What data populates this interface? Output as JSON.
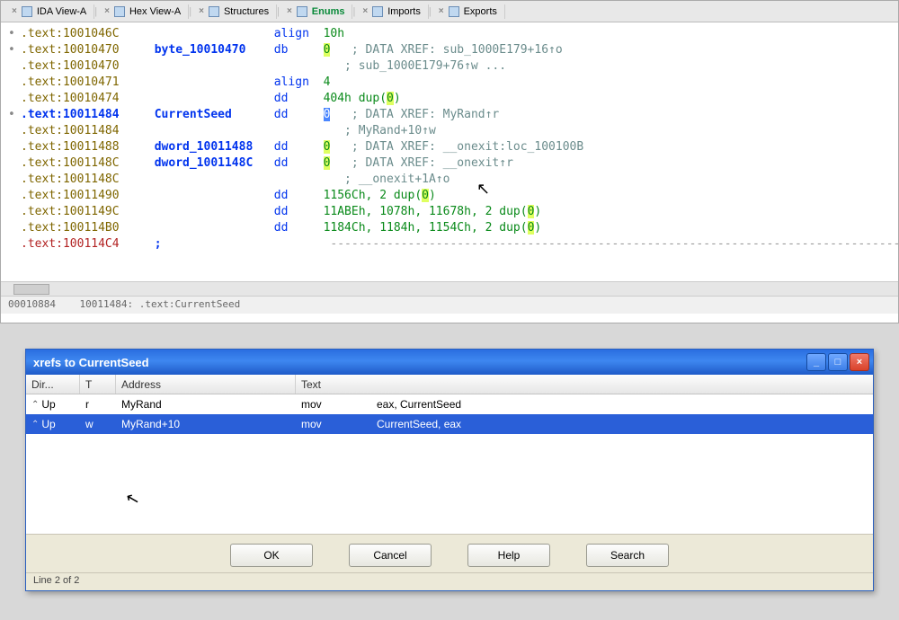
{
  "tabs": [
    {
      "label": "IDA View-A",
      "active": false
    },
    {
      "label": "Hex View-A",
      "active": false
    },
    {
      "label": "Structures",
      "active": false
    },
    {
      "label": "Enums",
      "active": true
    },
    {
      "label": "Imports",
      "active": false
    },
    {
      "label": "Exports",
      "active": false
    }
  ],
  "disasm_lines": [
    {
      "arrow": "•",
      "addr": ".text:1001046C",
      "label": "",
      "op": "align",
      "args": "10h",
      "cmt": ""
    },
    {
      "arrow": "•",
      "addr": ".text:10010470",
      "label": "byte_10010470",
      "op": "db",
      "args": "0",
      "hl": true,
      "cmt": "; DATA XREF: sub_1000E179+16↑o"
    },
    {
      "arrow": " ",
      "addr": ".text:10010470",
      "label": "",
      "op": "",
      "args": "",
      "cmt": "; sub_1000E179+76↑w ..."
    },
    {
      "arrow": " ",
      "addr": ".text:10010471",
      "label": "",
      "op": "align",
      "args": "4",
      "cmt": ""
    },
    {
      "arrow": " ",
      "addr": ".text:10010474",
      "label": "",
      "op": "dd",
      "args": "404h dup(0)",
      "hlparen": true,
      "cmt": ""
    },
    {
      "arrow": "•",
      "addr": ".text:10011484",
      "label": "CurrentSeed",
      "bold": true,
      "op": "dd",
      "args": "0",
      "hlsel": true,
      "cmt": "; DATA XREF: MyRand↑r"
    },
    {
      "arrow": " ",
      "addr": ".text:10011484",
      "label": "",
      "op": "",
      "args": "",
      "cmt": "; MyRand+10↑w"
    },
    {
      "arrow": " ",
      "addr": ".text:10011488",
      "label": "dword_10011488",
      "op": "dd",
      "args": "0",
      "hl": true,
      "cmt": "; DATA XREF: __onexit:loc_100100B"
    },
    {
      "arrow": " ",
      "addr": ".text:1001148C",
      "label": "dword_1001148C",
      "op": "dd",
      "args": "0",
      "hl": true,
      "cmt": "; DATA XREF: __onexit↑r"
    },
    {
      "arrow": " ",
      "addr": ".text:1001148C",
      "label": "",
      "op": "",
      "args": "",
      "cmt": "; __onexit+1A↑o"
    },
    {
      "arrow": " ",
      "addr": ".text:10011490",
      "label": "",
      "op": "dd",
      "args": "1156Ch, 2 dup(0)",
      "hlparen": true,
      "cmt": ""
    },
    {
      "arrow": " ",
      "addr": ".text:1001149C",
      "label": "",
      "op": "dd",
      "args": "11ABEh, 1078h, 11678h, 2 dup(0)",
      "hlparen": true,
      "cmt": ""
    },
    {
      "arrow": " ",
      "addr": ".text:100114B0",
      "label": "",
      "op": "dd",
      "args": "1184Ch, 1184h, 1154Ch, 2 dup(0)",
      "hlparen": true,
      "cmt": ""
    },
    {
      "arrow": " ",
      "addr": ".text:100114C4",
      "red": true,
      "label": ";",
      "op": "",
      "args": "",
      "dashed": true,
      "cmt": ""
    }
  ],
  "status": {
    "offset": "00010884",
    "addr": "10011484: .text:CurrentSeed"
  },
  "dialog": {
    "title": "xrefs to CurrentSeed",
    "columns": {
      "dir": "Dir...",
      "t": "T",
      "addr": "Address",
      "text": "Text"
    },
    "rows": [
      {
        "dir": "Up",
        "t": "r",
        "addr": "MyRand",
        "instr": "mov",
        "ops": "eax, CurrentSeed",
        "selected": false
      },
      {
        "dir": "Up",
        "t": "w",
        "addr": "MyRand+10",
        "instr": "mov",
        "ops": "CurrentSeed, eax",
        "selected": true
      }
    ],
    "buttons": {
      "ok": "OK",
      "cancel": "Cancel",
      "help": "Help",
      "search": "Search"
    },
    "status": "Line 2 of 2"
  }
}
